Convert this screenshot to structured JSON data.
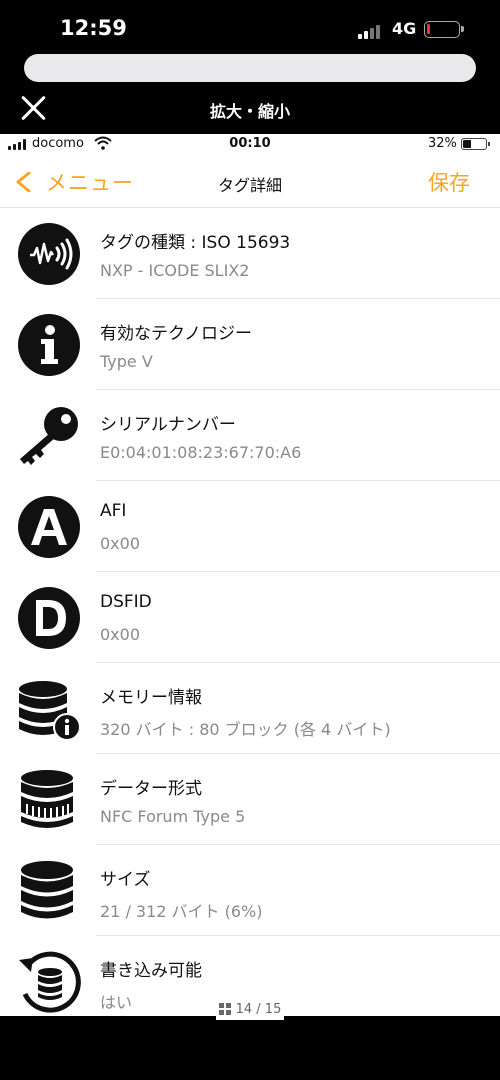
{
  "outer_status": {
    "time": "12:59",
    "network": "4G"
  },
  "viewer": {
    "title": "拡大・縮小"
  },
  "inner_status": {
    "carrier": "docomo",
    "time": "00:10",
    "battery": "32%"
  },
  "nav": {
    "back_label": "メニュー",
    "title": "タグ詳細",
    "save_label": "保存"
  },
  "rows": [
    {
      "icon": "nfc-wave-icon",
      "title": "タグの種類 : ISO 15693",
      "sub": "NXP - ICODE SLIX2"
    },
    {
      "icon": "info-icon",
      "title": "有効なテクノロジー",
      "sub": "Type V"
    },
    {
      "icon": "key-icon",
      "title": "シリアルナンバー",
      "sub": "E0:04:01:08:23:67:70:A6"
    },
    {
      "icon": "letter-a-icon",
      "title": "AFI",
      "sub": "0x00"
    },
    {
      "icon": "letter-d-icon",
      "title": "DSFID",
      "sub": "0x00"
    },
    {
      "icon": "database-info-icon",
      "title": "メモリー情報",
      "sub": "320 バイト : 80 ブロック (各 4 バイト)"
    },
    {
      "icon": "database-format-icon",
      "title": "データー形式",
      "sub": "NFC Forum Type 5"
    },
    {
      "icon": "database-icon",
      "title": "サイズ",
      "sub": "21 / 312 バイト (6%)"
    },
    {
      "icon": "database-refresh-icon",
      "title": "書き込み可能",
      "sub": "はい"
    }
  ],
  "page_indicator": "14 / 15",
  "colors": {
    "accent": "#f5a623",
    "icon": "#111111",
    "background": "#ffffff"
  }
}
